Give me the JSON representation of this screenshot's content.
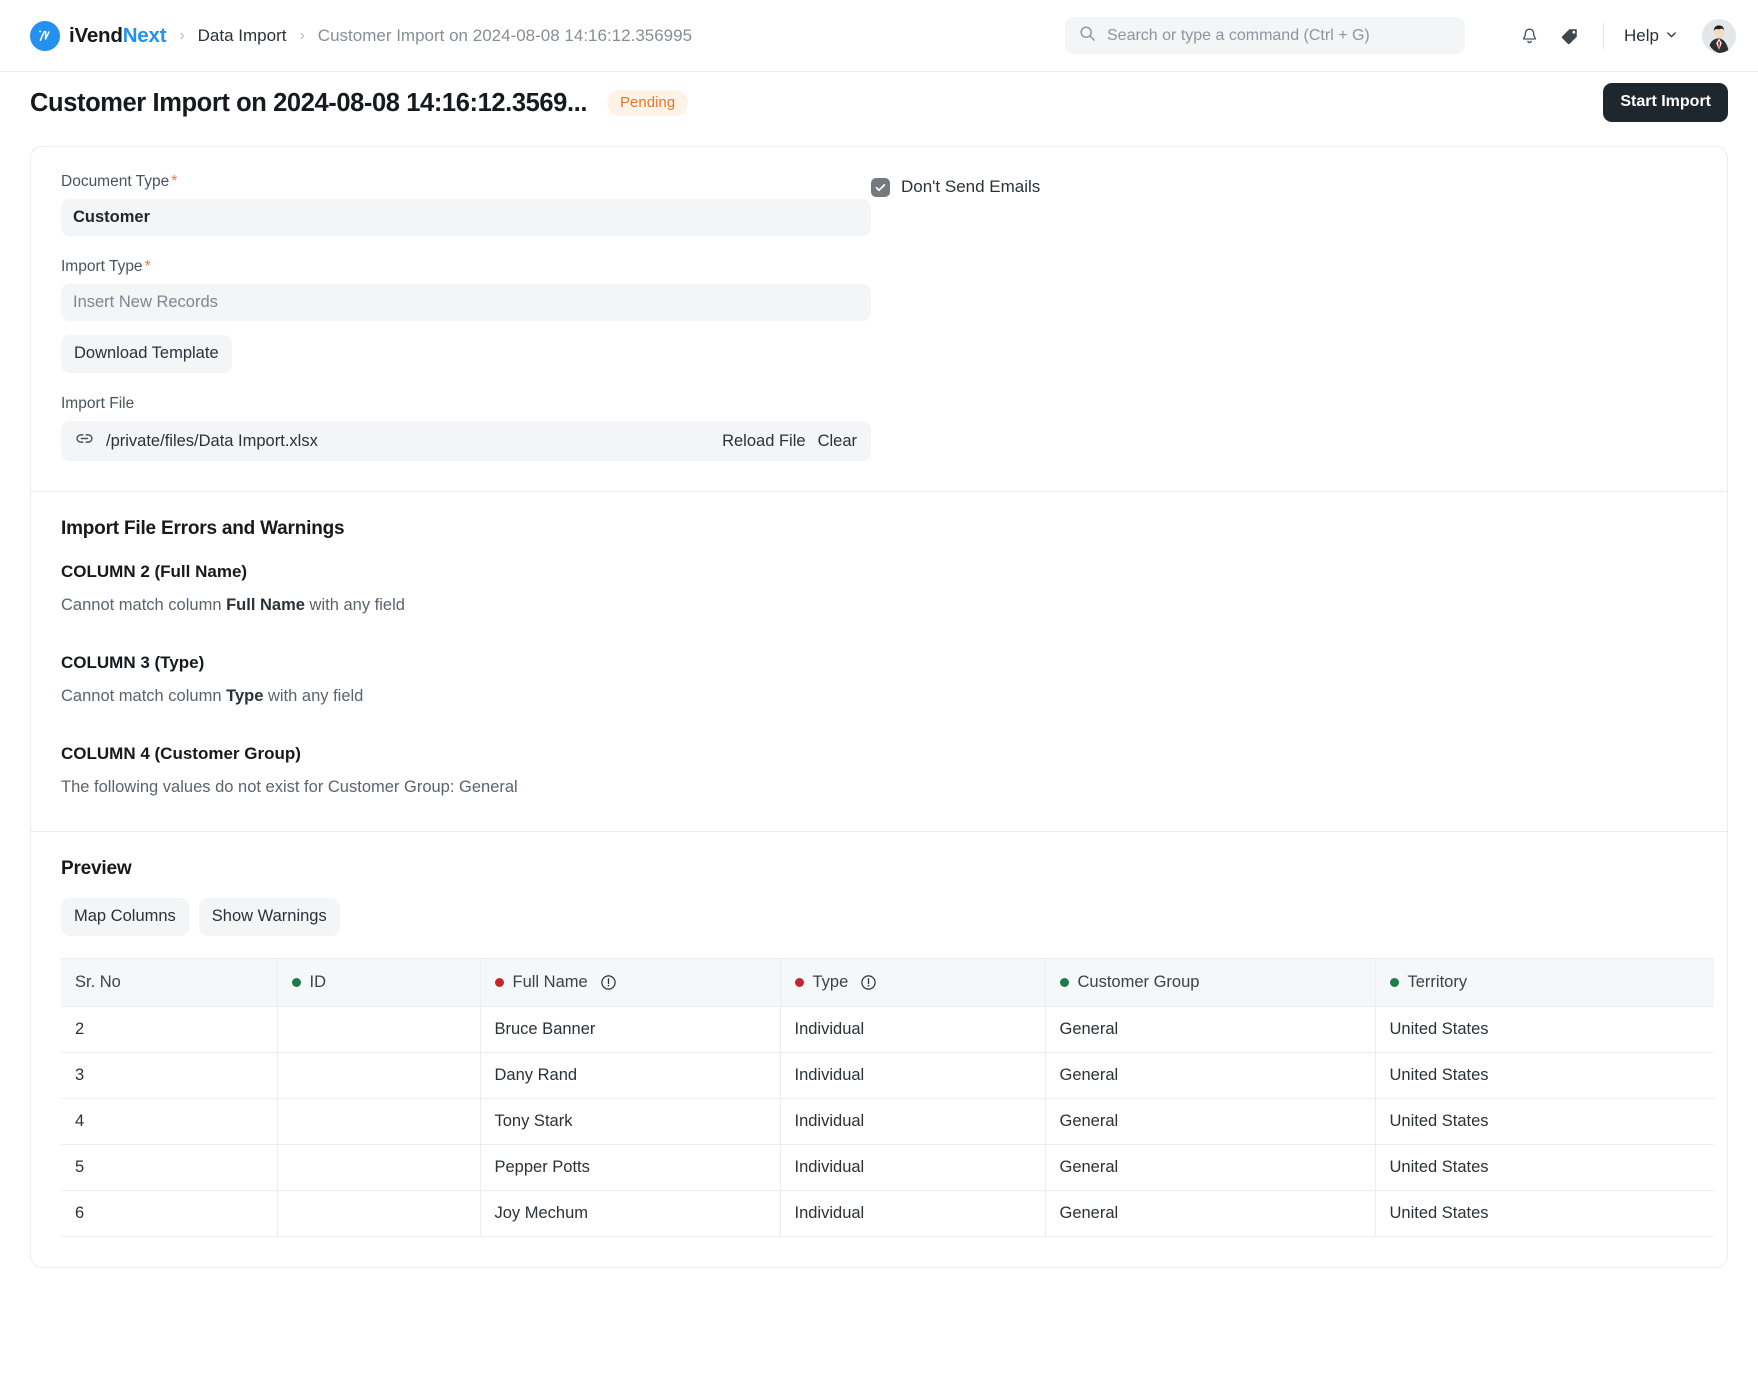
{
  "navbar": {
    "brand_first": "iVend",
    "brand_second": "Next",
    "brand_logo_icon": "ivend-logo-icon",
    "breadcrumbs": [
      {
        "label": "Data Import",
        "muted": false
      },
      {
        "label": "Customer Import on 2024-08-08 14:16:12.356995",
        "muted": true
      }
    ],
    "separator": "›",
    "search": {
      "placeholder": "Search or type a command (Ctrl + G)",
      "value": "",
      "icon": "search-icon"
    },
    "notifications_icon": "bell-icon",
    "tag_icon": "tag-icon",
    "help_label": "Help",
    "help_chevron_icon": "chevron-down-icon",
    "avatar_icon": "user-avatar"
  },
  "page": {
    "title": "Customer Import on 2024-08-08 14:16:12.3569...",
    "status_badge": "Pending",
    "primary_action": "Start Import"
  },
  "form": {
    "document_type": {
      "label": "Document Type",
      "required_marker": "*",
      "value": "Customer"
    },
    "import_type": {
      "label": "Import Type",
      "required_marker": "*",
      "value": "Insert New Records"
    },
    "download_template_label": "Download Template",
    "import_file": {
      "label": "Import File",
      "link_icon": "link-icon",
      "path": "/private/files/Data Import.xlsx",
      "reload_label": "Reload File",
      "clear_label": "Clear"
    },
    "dont_send_emails": {
      "label": "Don't Send Emails",
      "checked": true,
      "check_icon": "check-icon"
    }
  },
  "errors_section": {
    "title": "Import File Errors and Warnings",
    "items": [
      {
        "heading": "COLUMN 2 (Full Name)",
        "message_prefix": "Cannot match column ",
        "message_bold": "Full Name",
        "message_suffix": " with any field"
      },
      {
        "heading": "COLUMN 3 (Type)",
        "message_prefix": "Cannot match column ",
        "message_bold": "Type",
        "message_suffix": " with any field"
      },
      {
        "heading": "COLUMN 4 (Customer Group)",
        "message_prefix": "The following values do not exist for Customer Group: General",
        "message_bold": "",
        "message_suffix": ""
      }
    ]
  },
  "preview": {
    "title": "Preview",
    "map_columns_label": "Map Columns",
    "show_warnings_label": "Show Warnings",
    "table": {
      "columns": [
        {
          "label": "Sr. No",
          "dot": "",
          "warning": false
        },
        {
          "label": "ID",
          "dot": "green",
          "warning": false
        },
        {
          "label": "Full Name",
          "dot": "red",
          "warning": true
        },
        {
          "label": "Type",
          "dot": "red",
          "warning": true
        },
        {
          "label": "Customer Group",
          "dot": "green",
          "warning": false
        },
        {
          "label": "Territory",
          "dot": "green",
          "warning": false
        }
      ],
      "rows": [
        {
          "sr_no": "2",
          "id": "",
          "full_name": "Bruce Banner",
          "type": "Individual",
          "customer_group": "General",
          "territory": "United States"
        },
        {
          "sr_no": "3",
          "id": "",
          "full_name": "Dany Rand",
          "type": "Individual",
          "customer_group": "General",
          "territory": "United States"
        },
        {
          "sr_no": "4",
          "id": "",
          "full_name": "Tony Stark",
          "type": "Individual",
          "customer_group": "General",
          "territory": "United States"
        },
        {
          "sr_no": "5",
          "id": "",
          "full_name": "Pepper Potts",
          "type": "Individual",
          "customer_group": "General",
          "territory": "United States"
        },
        {
          "sr_no": "6",
          "id": "",
          "full_name": "Joy Mechum",
          "type": "Individual",
          "customer_group": "General",
          "territory": "United States"
        }
      ]
    }
  },
  "colors": {
    "brand_blue": "#2490ef",
    "dark_button": "#1f272e",
    "badge_text": "#e8762a",
    "badge_bg": "#fff3e8",
    "dot_green": "#1e7a47",
    "dot_red": "#c3282d",
    "field_bg": "#f4f5f6"
  }
}
